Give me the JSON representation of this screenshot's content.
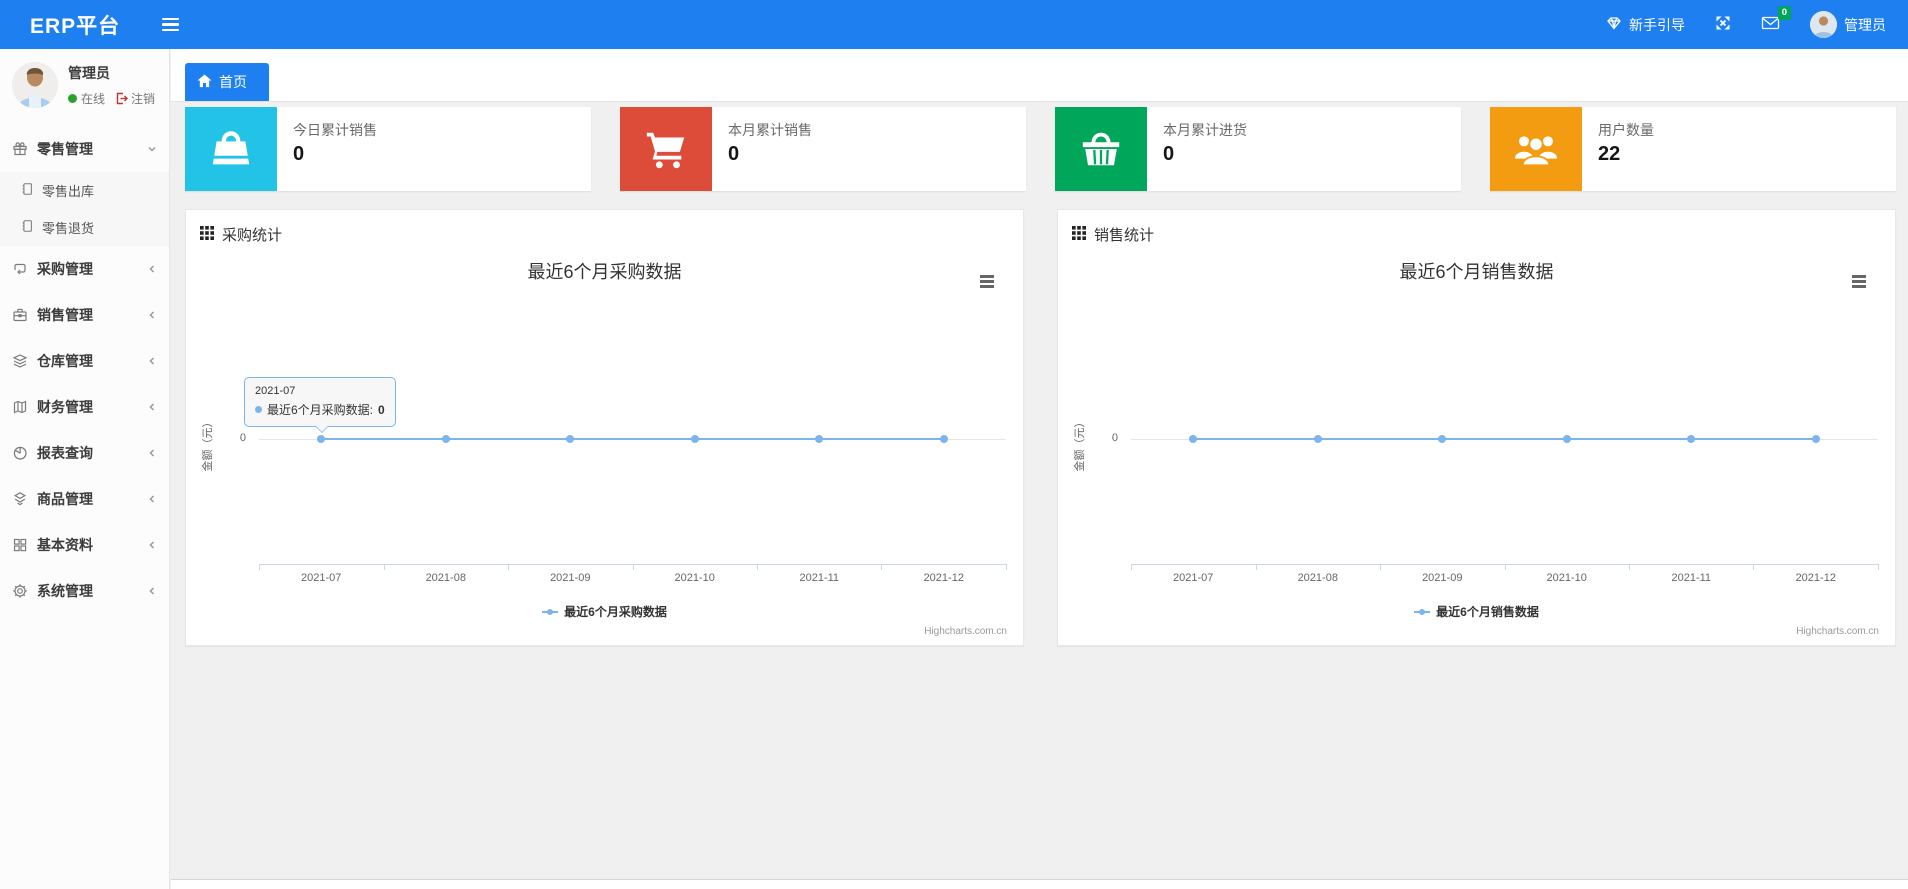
{
  "navbar": {
    "brand": "ERP平台",
    "guide": {
      "label": "新手引导",
      "icon": "gem-icon"
    },
    "fullscreen_icon": "fullscreen-icon",
    "messages": {
      "icon": "envelope-icon",
      "badge": "0",
      "badge_color": "#00a65a"
    },
    "user": {
      "name": "管理员"
    },
    "color": "#1e80f0"
  },
  "sidebar": {
    "user_panel": {
      "name": "管理员",
      "status_label": "在线",
      "logout_label": "注销",
      "status_color": "#2e9e2e"
    },
    "menu": [
      {
        "label": "零售管理",
        "icon": "gift-icon",
        "state": "expanded"
      },
      {
        "label": "采购管理",
        "icon": "repeat-icon",
        "state": "collapsed"
      },
      {
        "label": "销售管理",
        "icon": "briefcase-icon",
        "state": "collapsed"
      },
      {
        "label": "仓库管理",
        "icon": "layers-icon",
        "state": "collapsed"
      },
      {
        "label": "财务管理",
        "icon": "map-icon",
        "state": "collapsed"
      },
      {
        "label": "报表查询",
        "icon": "pie-chart-icon",
        "state": "collapsed"
      },
      {
        "label": "商品管理",
        "icon": "dropbox-icon",
        "state": "collapsed"
      },
      {
        "label": "基本资料",
        "icon": "grid-icon",
        "state": "collapsed"
      },
      {
        "label": "系统管理",
        "icon": "gear-icon",
        "state": "collapsed"
      }
    ],
    "submenu": [
      {
        "label": "零售出库",
        "icon": "journal-icon"
      },
      {
        "label": "零售退货",
        "icon": "journal-icon"
      }
    ]
  },
  "tab_bar": {
    "active_tab": "首页",
    "icon": "home-icon"
  },
  "stat_cards": [
    {
      "title": "今日累计销售",
      "value": "0",
      "color": "#23c3e8",
      "icon": "shopping-bag-icon"
    },
    {
      "title": "本月累计销售",
      "value": "0",
      "color": "#dd4b39",
      "icon": "shopping-cart-icon"
    },
    {
      "title": "本月累计进货",
      "value": "0",
      "color": "#00a65a",
      "icon": "shopping-basket-icon"
    },
    {
      "title": "用户数量",
      "value": "22",
      "color": "#f39c12",
      "icon": "users-icon"
    }
  ],
  "panels": [
    {
      "title": "采购统计"
    },
    {
      "title": "销售统计"
    }
  ],
  "chart_data": [
    {
      "type": "line",
      "title": "最近6个月采购数据",
      "categories": [
        "2021-07",
        "2021-08",
        "2021-09",
        "2021-10",
        "2021-11",
        "2021-12"
      ],
      "series": [
        {
          "name": "最近6个月采购数据",
          "values": [
            0,
            0,
            0,
            0,
            0,
            0
          ],
          "color": "#7cb5ec"
        }
      ],
      "ylabel": "金额（元）",
      "yticks": [
        "0"
      ],
      "ylim": [
        0,
        1
      ],
      "grid": true,
      "legend_position": "bottom",
      "credits": "Highcharts.com.cn",
      "tooltip": {
        "visible": true,
        "date": "2021-07",
        "label": "最近6个月采购数据:",
        "value": "0"
      }
    },
    {
      "type": "line",
      "title": "最近6个月销售数据",
      "categories": [
        "2021-07",
        "2021-08",
        "2021-09",
        "2021-10",
        "2021-11",
        "2021-12"
      ],
      "series": [
        {
          "name": "最近6个月销售数据",
          "values": [
            0,
            0,
            0,
            0,
            0,
            0
          ],
          "color": "#7cb5ec"
        }
      ],
      "ylabel": "金额（元）",
      "yticks": [
        "0"
      ],
      "ylim": [
        0,
        1
      ],
      "grid": true,
      "legend_position": "bottom",
      "credits": "Highcharts.com.cn",
      "tooltip": {
        "visible": false
      }
    }
  ]
}
